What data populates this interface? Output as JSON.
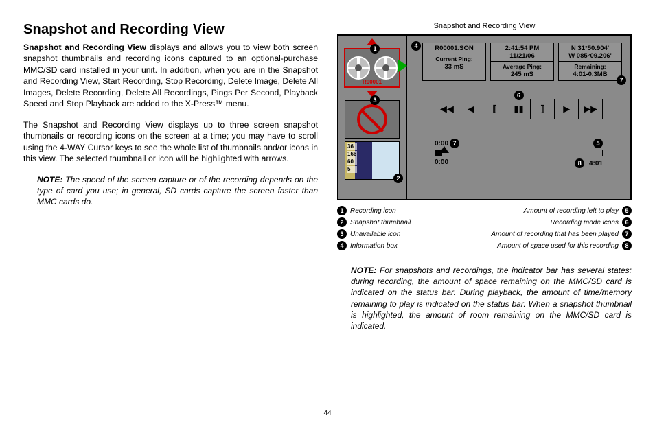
{
  "page_number": "44",
  "heading": "Snapshot and Recording View",
  "lead_bold": "Snapshot and Recording View",
  "para1_rest": " displays and allows you to view both screen snapshot thumbnails and recording icons captured to an optional-purchase MMC/SD card installed in your unit. In addition, when you are in the Snapshot and Recording View, Start Recording, Stop Recording, Delete Image, Delete All Images, Delete Recording, Delete All Recordings, Pings Per Second, Playback Speed and Stop Playback are added to the X-Press™ menu.",
  "para2": "The Snapshot and Recording View displays up to three screen snapshot thumbnails or recording icons on the screen at a time; you may have to scroll using the 4-WAY Cursor keys to see the whole list of thumbnails and/or icons in this view. The selected thumbnail or icon will be highlighted with arrows.",
  "note1_label": "NOTE:",
  "note1_body": " The speed of the screen capture or of the recording depends on the type of card you use; in general, SD cards capture the screen faster than MMC cards do.",
  "figure_title": "Snapshot and Recording View",
  "info": {
    "file": "R00001.SON",
    "time": "2:41:54 PM",
    "date": "11/21/06",
    "lat": "N 31°50.904'",
    "lon": "W 085°09.206'",
    "cur_label": "Current Ping:",
    "cur_val": "33 mS",
    "avg_label": "Average Ping:",
    "avg_val": "245 mS",
    "rem_label": "Remaining:",
    "rem_val": "4:01-0.3MB"
  },
  "rec_name": "R00001",
  "snap_scale": [
    "36",
    "166",
    "60",
    "5"
  ],
  "prog": {
    "t_left_top": "0:00",
    "t_left_bot": "0:00",
    "t_right": "4:01"
  },
  "controls_glyphs": [
    "◀◀",
    "◀",
    "�【",
    "▌▌",
    "】▶",
    "▶",
    "▶▶"
  ],
  "legend_left": [
    {
      "n": "1",
      "t": "Recording icon"
    },
    {
      "n": "2",
      "t": "Snapshot thumbnail"
    },
    {
      "n": "3",
      "t": "Unavailable icon"
    },
    {
      "n": "4",
      "t": "Information box"
    }
  ],
  "legend_right": [
    {
      "n": "5",
      "t": "Amount of recording left to play"
    },
    {
      "n": "6",
      "t": "Recording mode icons"
    },
    {
      "n": "7",
      "t": "Amount of recording that has been played"
    },
    {
      "n": "8",
      "t": "Amount of space used for this recording"
    }
  ],
  "note2_label": "NOTE:",
  "note2_body": " For snapshots and recordings, the indicator bar has several states: during recording, the amount of space remaining on the MMC/SD card is indicated on the status bar. During playback, the amount of time/memory remaining to play is indicated on the status bar. When a snapshot thumbnail is highlighted, the amount of room remaining on the MMC/SD card is indicated."
}
